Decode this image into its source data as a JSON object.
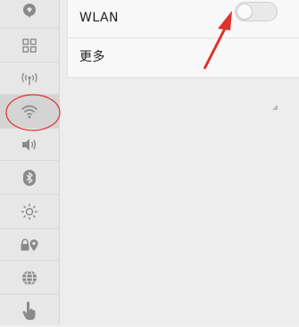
{
  "settings": {
    "wlan": {
      "label": "WLAN",
      "enabled": false
    },
    "more": {
      "label": "更多"
    }
  },
  "sidebar": {
    "items": [
      {
        "icon": "location-icon"
      },
      {
        "icon": "grid-icon"
      },
      {
        "icon": "antenna-icon"
      },
      {
        "icon": "wifi-icon",
        "selected": true
      },
      {
        "icon": "speaker-icon"
      },
      {
        "icon": "bluetooth-icon"
      },
      {
        "icon": "brightness-icon"
      },
      {
        "icon": "lock-location-icon"
      },
      {
        "icon": "globe-icon"
      },
      {
        "icon": "hand-pointer-icon"
      }
    ]
  },
  "colors": {
    "sidebar_bg": "#e7e7e7",
    "icon": "#8a8a8a",
    "annotation_red": "#e0312b"
  }
}
